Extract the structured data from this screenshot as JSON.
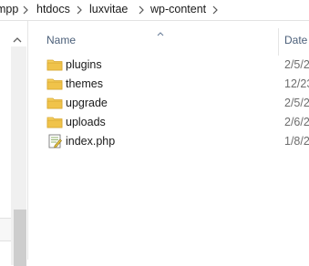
{
  "breadcrumb": {
    "items": [
      "mpp",
      "htdocs",
      "luxvitae",
      "wp-content"
    ]
  },
  "columns": {
    "name": "Name",
    "date": "Date"
  },
  "files": [
    {
      "name": "plugins",
      "type": "folder",
      "date": "2/5/2"
    },
    {
      "name": "themes",
      "type": "folder",
      "date": "12/23"
    },
    {
      "name": "upgrade",
      "type": "folder",
      "date": "2/5/2"
    },
    {
      "name": "uploads",
      "type": "folder",
      "date": "2/6/2"
    },
    {
      "name": "index.php",
      "type": "php-file",
      "date": "1/8/2"
    }
  ],
  "colors": {
    "folder": "#f0c34a",
    "header_text": "#4c607a",
    "scrollbar_thumb": "#cdcdcd"
  }
}
